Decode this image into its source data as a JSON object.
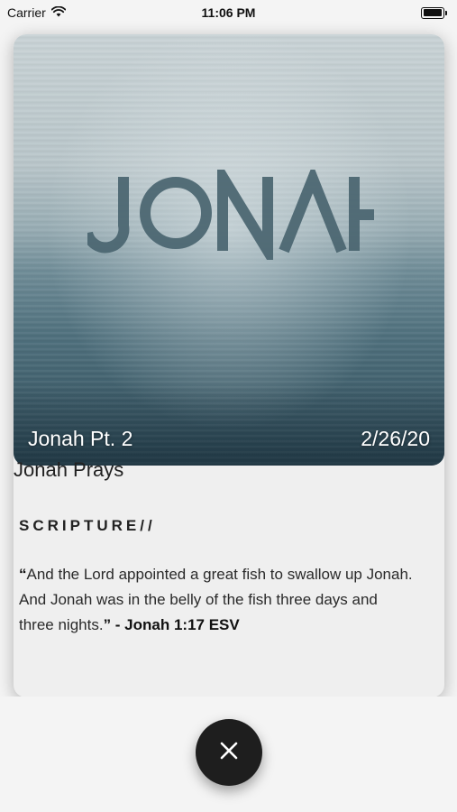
{
  "status_bar": {
    "carrier": "Carrier",
    "time": "11:06 PM",
    "wifi_icon": "wifi-icon",
    "battery_icon": "battery-icon"
  },
  "sermon": {
    "artwork_title": "JONAH",
    "series_part": "Jonah Pt. 2",
    "date": "2/26/20",
    "title": "Jonah Prays",
    "section_heading": "SCRIPTURE//",
    "scripture_quote": "And the Lord appointed a great fish to swallow up Jonah. And Jonah was in the belly of the fish three days and three nights.",
    "scripture_reference": "- Jonah 1:17 ESV"
  },
  "close_button": {
    "icon": "close-icon"
  },
  "colors": {
    "close_button_bg": "#1e1e1e",
    "card_bg": "#efefef",
    "page_bg": "#f4f4f4"
  }
}
